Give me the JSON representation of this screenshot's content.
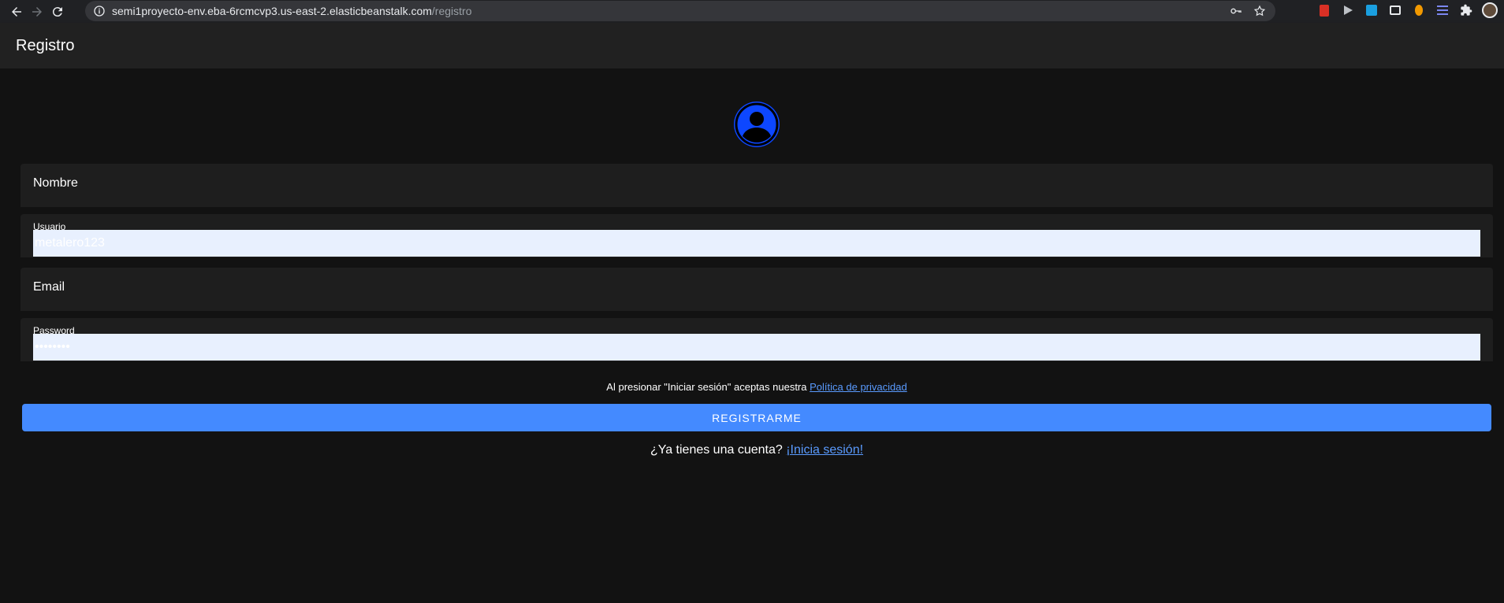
{
  "browser": {
    "url_host": "semi1proyecto-env.eba-6rcmcvp3.us-east-2.elasticbeanstalk.com",
    "url_path": "/registro"
  },
  "appbar": {
    "title": "Registro"
  },
  "form": {
    "nombre": {
      "label": "Nombre",
      "value": ""
    },
    "usuario": {
      "label": "Usuario",
      "value": "metalero123"
    },
    "email": {
      "label": "Email",
      "value": ""
    },
    "password": {
      "label": "Password",
      "value": "metalero"
    }
  },
  "terms": {
    "text": "Al presionar \"Iniciar sesión\" aceptas nuestra",
    "link": "Política de privacidad"
  },
  "register_button": "REGISTRARME",
  "signin": {
    "text": "¿Ya tienes una cuenta?",
    "link": "¡Inicia sesión!"
  },
  "colors": {
    "accent": "#448aff",
    "avatar": "#0d47ff",
    "appbar": "#212121",
    "background": "#121212"
  }
}
